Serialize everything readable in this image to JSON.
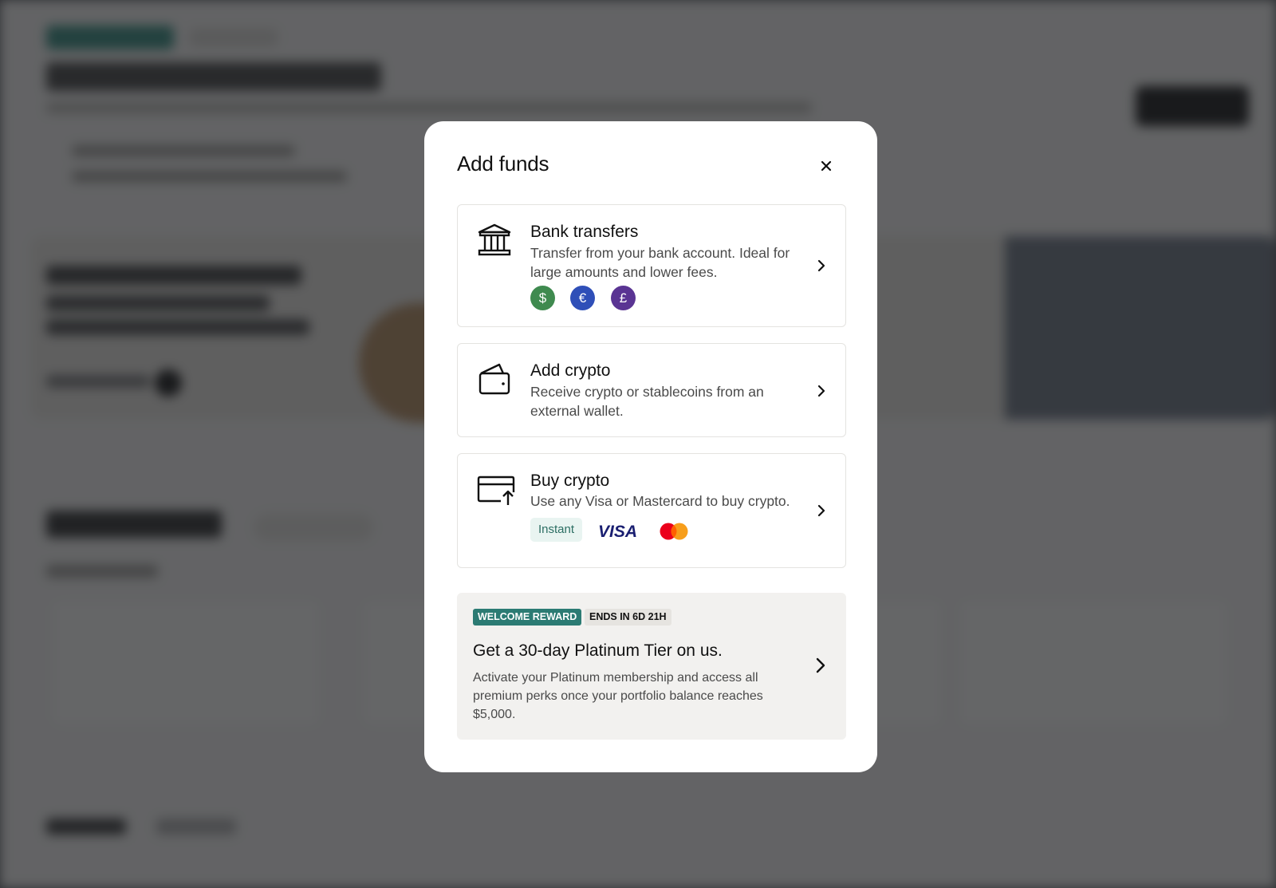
{
  "modal": {
    "title": "Add funds",
    "options": [
      {
        "title": "Bank transfers",
        "description": "Transfer from your bank account. Ideal for large amounts and lower fees.",
        "icon": "bank-icon",
        "currencies": [
          {
            "symbol": "$",
            "color": "#3f8a4f",
            "name": "dollar"
          },
          {
            "symbol": "€",
            "color": "#2f4fb8",
            "name": "euro"
          },
          {
            "symbol": "£",
            "color": "#5a3493",
            "name": "pound"
          }
        ]
      },
      {
        "title": "Add crypto",
        "description": "Receive crypto or stablecoins from an external wallet.",
        "icon": "wallet-icon"
      },
      {
        "title": "Buy crypto",
        "description": "Use any Visa or Mastercard to buy crypto.",
        "icon": "card-upload-icon",
        "tag": "Instant",
        "brands": [
          "VISA",
          "mastercard"
        ]
      }
    ],
    "promo": {
      "badge": "WELCOME REWARD",
      "countdown": "ENDS IN 6D 21H",
      "title": "Get a 30-day Platinum Tier on us.",
      "description": "Activate your Platinum membership and access all premium perks once your portfolio balance reaches $5,000."
    }
  },
  "colors": {
    "accent": "#2c7b73",
    "overlay": "#1e1f22"
  }
}
